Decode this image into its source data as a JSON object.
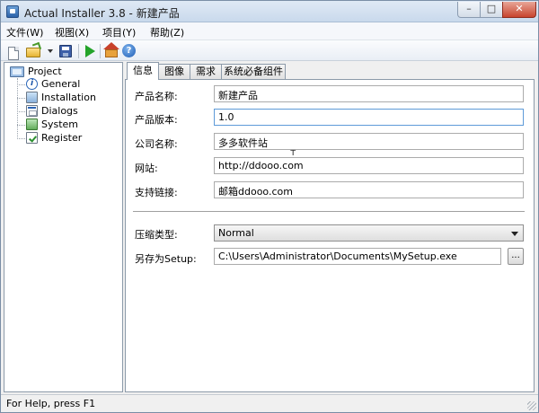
{
  "window": {
    "title": "Actual Installer 3.8 - 新建产品",
    "controls": {
      "minimize": "–",
      "maximize": "□",
      "close": "✕"
    }
  },
  "menu": [
    "文件(W)",
    "视图(X)",
    "项目(Y)",
    "帮助(Z)"
  ],
  "toolbar": {
    "buttons": [
      "new-icon",
      "open-icon",
      "dropdown-arrow",
      "save-icon",
      "run-icon",
      "home-icon",
      "help-icon"
    ],
    "help_glyph": "?"
  },
  "tree": {
    "root": "Project",
    "items": [
      {
        "label": "General",
        "icon": "info-icon",
        "glyph": "i"
      },
      {
        "label": "Installation",
        "icon": "installation-icon",
        "glyph": ""
      },
      {
        "label": "Dialogs",
        "icon": "dialogs-icon",
        "glyph": ""
      },
      {
        "label": "System",
        "icon": "system-icon",
        "glyph": ""
      },
      {
        "label": "Register",
        "icon": "register-icon",
        "glyph": ""
      }
    ]
  },
  "tabs": [
    "信息",
    "图像",
    "需求",
    "系统必备组件"
  ],
  "active_tab": "信息",
  "form": {
    "product_name": {
      "label": "产品名称:",
      "value": "新建产品"
    },
    "product_version": {
      "label": "产品版本:",
      "value": "1.0"
    },
    "company_name": {
      "label": "公司名称:",
      "value": "多多软件站"
    },
    "website": {
      "label": "网站:",
      "value": "http://ddooo.com"
    },
    "support_link": {
      "label": "支持链接:",
      "value": "邮箱ddooo.com"
    },
    "compression": {
      "label": "压缩类型:",
      "value": "Normal"
    },
    "save_as": {
      "label": "另存为Setup:",
      "value": "C:\\Users\\Administrator\\Documents\\MySetup.exe"
    },
    "browse_label": "...",
    "cursor_glyph": "ᴛ"
  },
  "status": {
    "text": "For Help, press F1"
  },
  "colors": {
    "accent": "#5e9ad8",
    "titlebar": "#c9d9ec"
  }
}
